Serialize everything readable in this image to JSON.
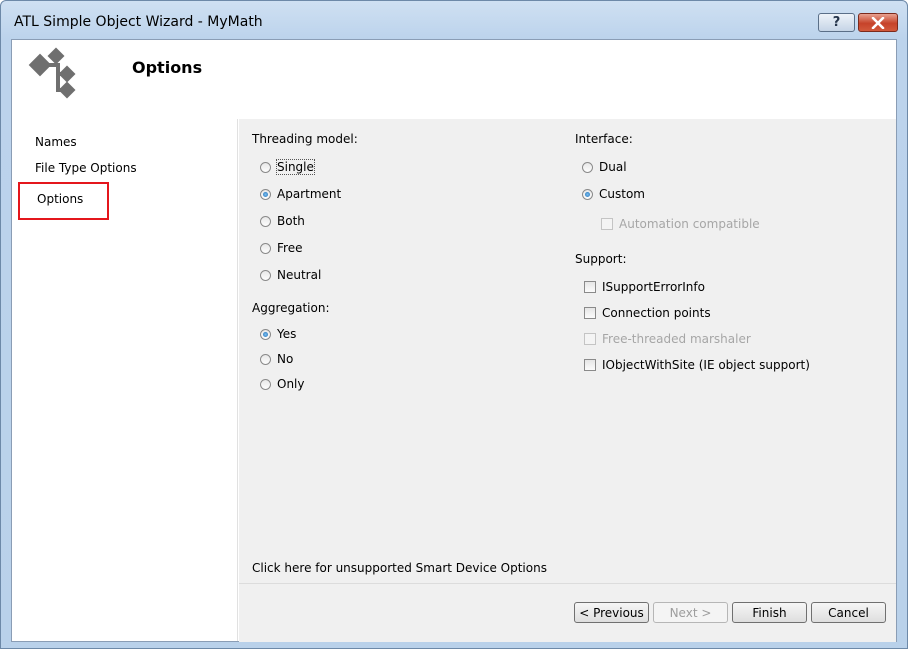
{
  "window": {
    "title": "ATL Simple Object Wizard - MyMath"
  },
  "titlebar": {
    "help_glyph": "?"
  },
  "header": {
    "page_title": "Options"
  },
  "nav": {
    "items": [
      {
        "label": "Names"
      },
      {
        "label": "File Type Options"
      },
      {
        "label": "Options"
      }
    ],
    "selected": "Options"
  },
  "threading": {
    "label": "Threading model:",
    "options": [
      {
        "label": "Single",
        "checked": false
      },
      {
        "label": "Apartment",
        "checked": true
      },
      {
        "label": "Both",
        "checked": false
      },
      {
        "label": "Free",
        "checked": false
      },
      {
        "label": "Neutral",
        "checked": false
      }
    ]
  },
  "aggregation": {
    "label": "Aggregation:",
    "options": [
      {
        "label": "Yes",
        "checked": true
      },
      {
        "label": "No",
        "checked": false
      },
      {
        "label": "Only",
        "checked": false
      }
    ]
  },
  "interface": {
    "label": "Interface:",
    "options": [
      {
        "label": "Dual",
        "checked": false
      },
      {
        "label": "Custom",
        "checked": true
      }
    ],
    "automation": {
      "label": "Automation compatible",
      "checked": false,
      "enabled": false
    }
  },
  "support": {
    "label": "Support:",
    "items": [
      {
        "label": "ISupportErrorInfo",
        "checked": false,
        "enabled": true
      },
      {
        "label": "Connection points",
        "checked": false,
        "enabled": true
      },
      {
        "label": "Free-threaded marshaler",
        "checked": false,
        "enabled": false
      },
      {
        "label": "IObjectWithSite (IE object support)",
        "checked": false,
        "enabled": true
      }
    ]
  },
  "smart_device_link": "Click here for unsupported Smart Device Options",
  "buttons": {
    "previous": "< Previous",
    "next": "Next >",
    "finish": "Finish",
    "cancel": "Cancel"
  }
}
